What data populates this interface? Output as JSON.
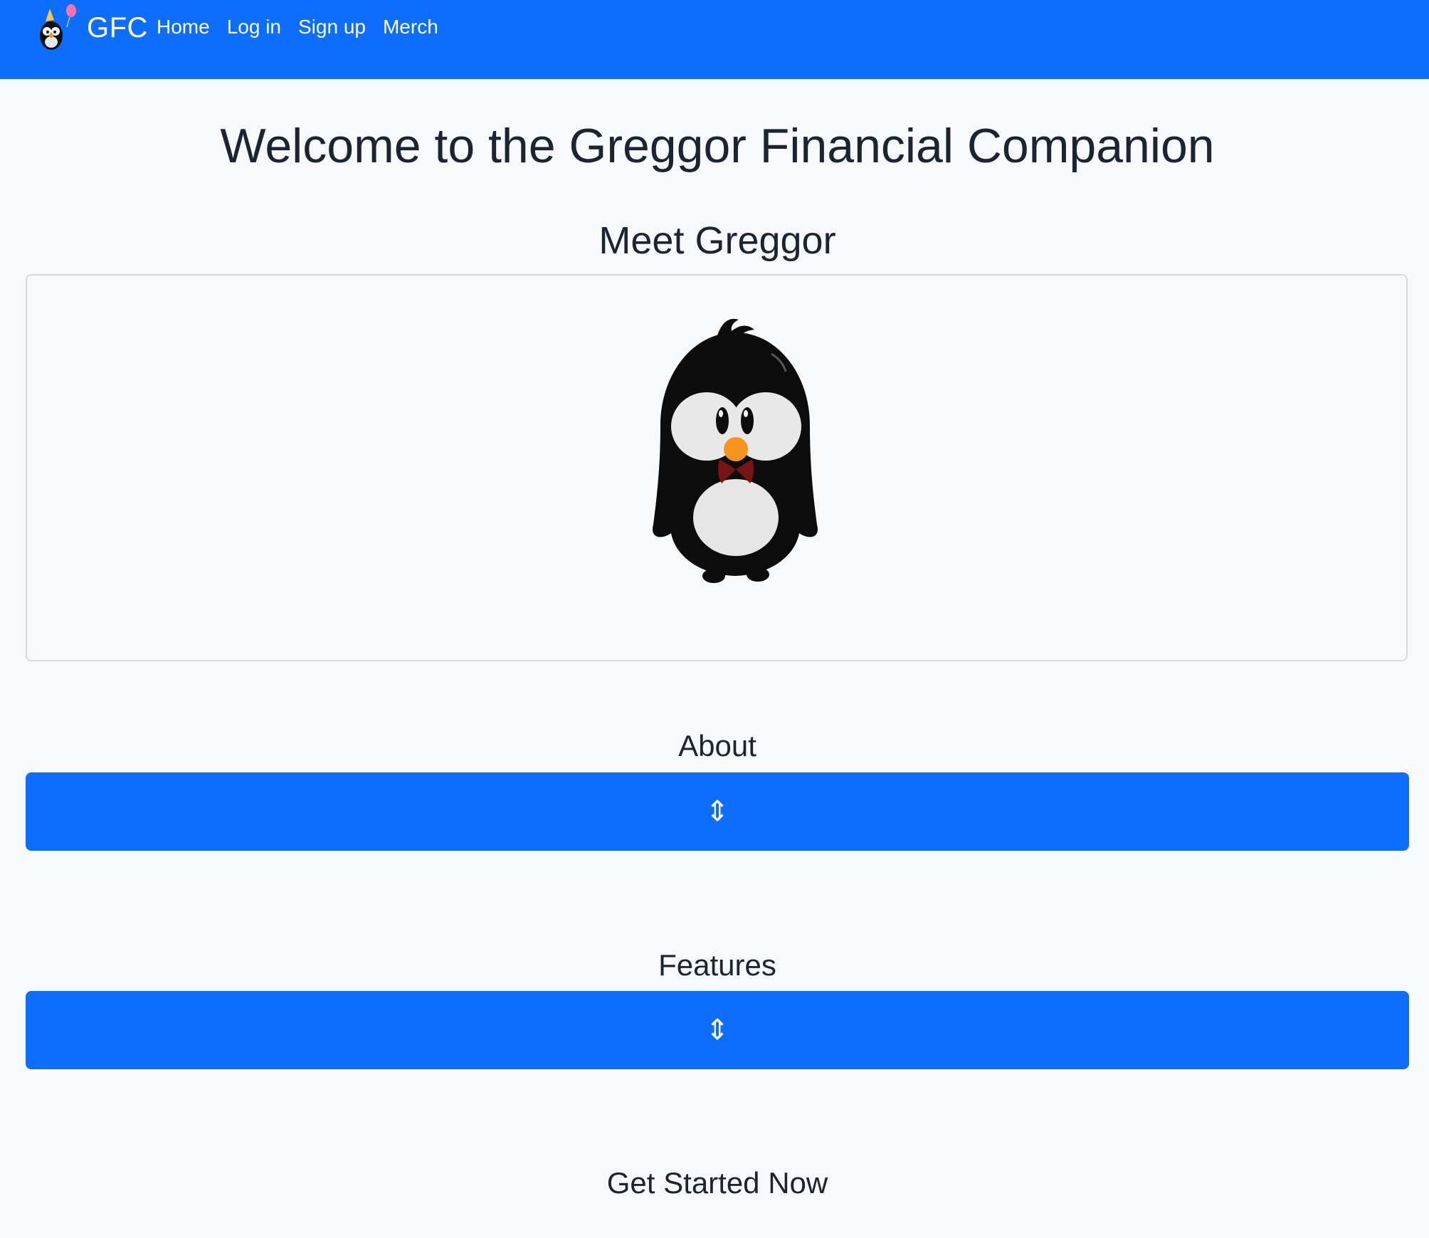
{
  "navbar": {
    "brand": "GFC",
    "links": [
      "Home",
      "Log in",
      "Sign up",
      "Merch"
    ],
    "color": "#0d6efd"
  },
  "main": {
    "title": "Welcome to the Greggor Financial Companion",
    "mascot_heading": "Meet Greggor",
    "mascot_icon": "penguin-mascot",
    "sections": [
      {
        "heading": "About",
        "toggle_icon": "⇕"
      },
      {
        "heading": "Features",
        "toggle_icon": "⇕"
      }
    ],
    "cta_heading": "Get Started Now"
  }
}
